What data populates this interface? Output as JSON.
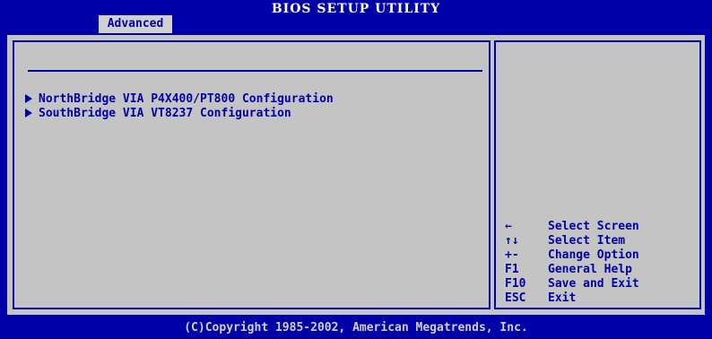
{
  "header": {
    "title": "BIOS SETUP UTILITY",
    "active_tab": "Advanced"
  },
  "menu": {
    "items": [
      {
        "label": "NorthBridge VIA P4X400/PT800 Configuration"
      },
      {
        "label": "SouthBridge VIA VT8237 Configuration"
      }
    ]
  },
  "help": {
    "keys": [
      {
        "key": "←",
        "icon": "left-arrow-icon",
        "desc": "Select Screen"
      },
      {
        "key": "↑↓",
        "icon": "up-down-arrow-icon",
        "desc": "Select Item"
      },
      {
        "key": "+-",
        "desc": "Change Option"
      },
      {
        "key": "F1",
        "desc": "General Help"
      },
      {
        "key": "F10",
        "desc": "Save and Exit"
      },
      {
        "key": "ESC",
        "desc": "Exit"
      }
    ]
  },
  "footer": {
    "copyright": "(C)Copyright 1985-2002, American Megatrends, Inc."
  },
  "colors": {
    "background": "#0000a8",
    "panel": "#c4c4c4",
    "text": "#0000a8",
    "header_text": "#ffffff"
  }
}
